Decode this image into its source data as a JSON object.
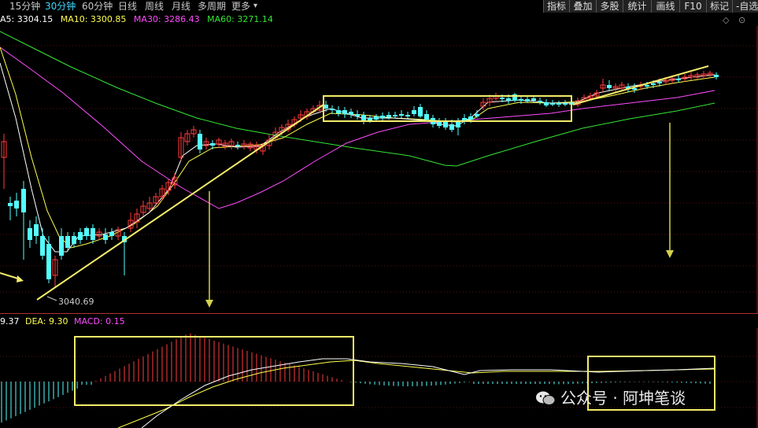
{
  "toolbar": {
    "periods": [
      {
        "label": "15分钟",
        "active": false
      },
      {
        "label": "30分钟",
        "active": true
      },
      {
        "label": "60分钟",
        "active": false
      },
      {
        "label": "日线",
        "active": false
      },
      {
        "label": "周线",
        "active": false
      },
      {
        "label": "月线",
        "active": false
      },
      {
        "label": "多周期",
        "active": false
      },
      {
        "label": "更多",
        "active": false
      }
    ],
    "more_arrow": "▾",
    "tools": [
      "指标",
      "叠加",
      "多股",
      "统计",
      "画线",
      "F10",
      "标记",
      "-自选"
    ]
  },
  "ma_legend": {
    "ma5": "A5: 3304.15",
    "ma10": "MA10: 3300.85",
    "ma30": "MA30: 3286.43",
    "ma60": "MA60: 3271.14"
  },
  "macd_legend": {
    "dif": "9.37",
    "dea": "DEA: 9.30",
    "macd": "MACD: 0.15"
  },
  "annotations": {
    "low_price": "3040.69"
  },
  "watermark": "公众号 · 阿坤笔谈",
  "colors": {
    "up": "#ff3c3c",
    "down": "#54ffff",
    "ma5": "#ffffff",
    "ma10": "#ffff4d",
    "ma30": "#ff4dff",
    "ma60": "#35e635",
    "highlight": "#f4ec6a",
    "active_period": "#3fd7ff"
  }
}
